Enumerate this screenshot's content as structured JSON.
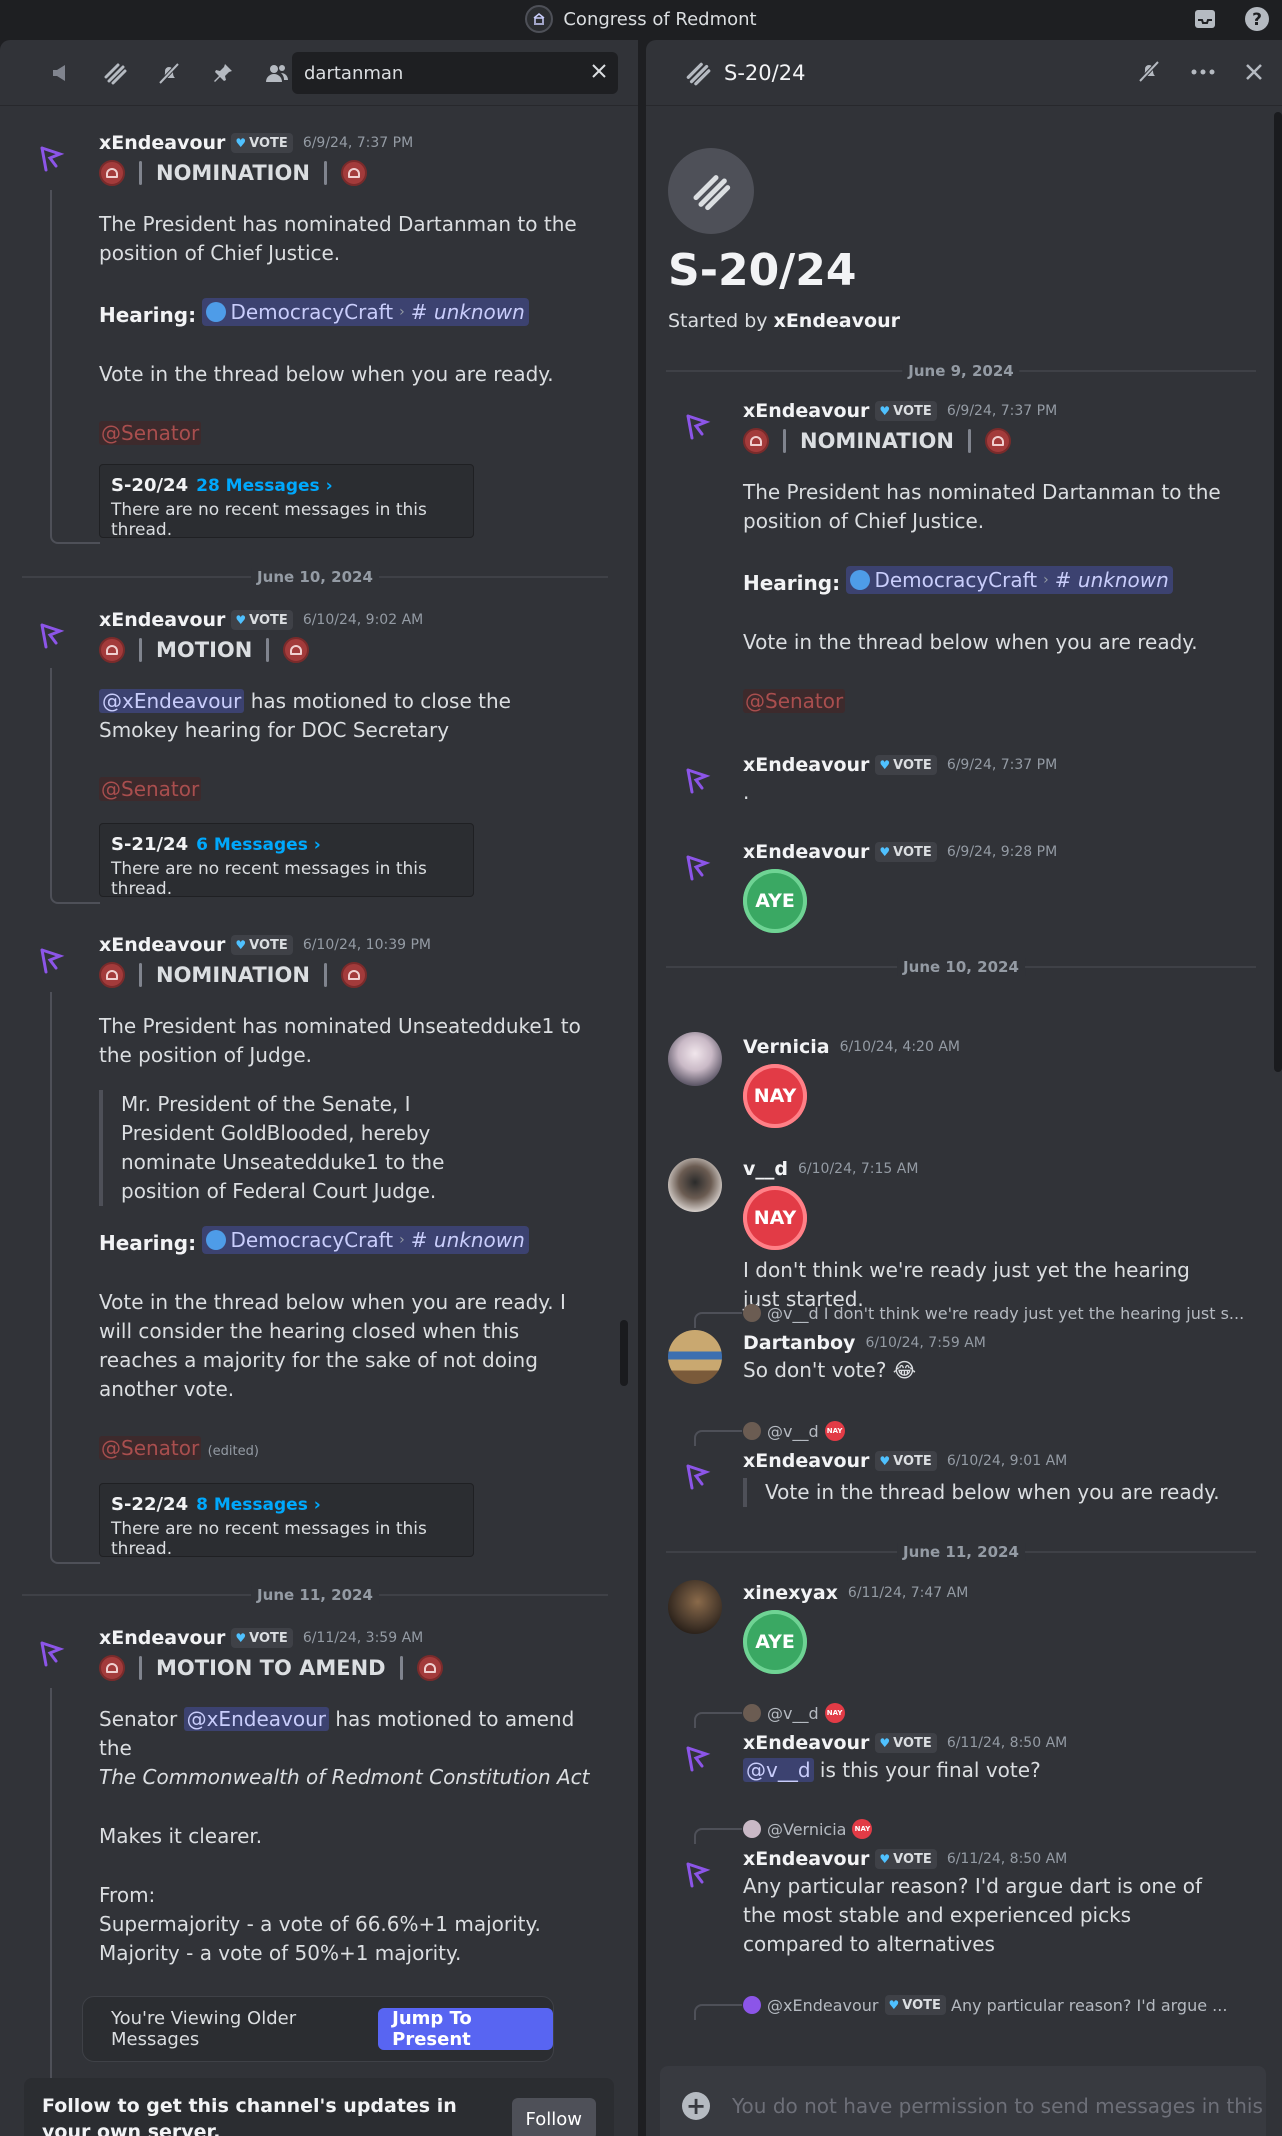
{
  "window": {
    "title": "Congress of Redmont"
  },
  "search": {
    "value": "dartanman"
  },
  "left_messages": [
    {
      "author": "xEndeavour",
      "badge": "VOTE",
      "time": "6/9/24, 7:37 PM",
      "heading": "NOMINATION",
      "p1": "The President has nominated Dartanman to the position of Chief Justice.",
      "hearing_label": "Hearing:",
      "channel": "DemocracyCraft",
      "subchannel": "unknown",
      "p2": "Vote in the thread below when you are ready.",
      "mention": "@Senator",
      "thread": {
        "name": "S-20/24",
        "count": "28 Messages ›",
        "note": "There are no recent messages in this thread."
      }
    },
    {
      "author": "xEndeavour",
      "badge": "VOTE",
      "time": "6/10/24, 9:02 AM",
      "heading": "MOTION",
      "mention_user": "@xEndeavour",
      "p1": " has motioned to close the Smokey hearing for DOC Secretary",
      "mention": "@Senator",
      "thread": {
        "name": "S-21/24",
        "count": "6 Messages ›",
        "note": "There are no recent messages in this thread."
      }
    },
    {
      "author": "xEndeavour",
      "badge": "VOTE",
      "time": "6/10/24, 10:39 PM",
      "heading": "NOMINATION",
      "p1": "The President has nominated Unseatedduke1 to the position of Judge.",
      "quote": "Mr. President of the Senate, I President GoldBlooded, hereby nominate Unseatedduke1 to the position of Federal Court Judge.",
      "hearing_label": "Hearing:",
      "channel": "DemocracyCraft",
      "subchannel": "unknown",
      "p2": "Vote in the thread below when you are ready. I will consider the hearing closed when this reaches a majority for the sake of not doing another vote.",
      "mention": "@Senator",
      "edited": "(edited)",
      "thread": {
        "name": "S-22/24",
        "count": "8 Messages ›",
        "note": "There are no recent messages in this thread."
      }
    },
    {
      "author": "xEndeavour",
      "badge": "VOTE",
      "time": "6/11/24, 3:59 AM",
      "heading": "MOTION TO AMEND",
      "pre": "Senator ",
      "mention_user": "@xEndeavour",
      "p1": " has motioned to amend the",
      "act": "The Commonwealth of Redmont Constitution Act",
      "p2": "Makes it clearer.",
      "p3": "From:",
      "p4": "Supermajority - a vote of 66.6%+1 majority.",
      "p5": "Majority - a vote of 50%+1 majority."
    }
  ],
  "left_dividers": [
    "June 10, 2024",
    "June 11, 2024"
  ],
  "older_bar": {
    "text": "You're Viewing Older Messages",
    "button": "Jump To Present"
  },
  "follow_bar": {
    "text": "Follow to get this channel's updates in your own server.",
    "button": "Follow"
  },
  "thread_panel": {
    "title": "S-20/24",
    "started_prefix": "Started by ",
    "starter": "xEndeavour",
    "dividers": [
      "June 9, 2024",
      "June 10, 2024",
      "June 11, 2024"
    ],
    "msg1": {
      "author": "xEndeavour",
      "badge": "VOTE",
      "time": "6/9/24, 7:37 PM",
      "heading": "NOMINATION",
      "p1": "The President has nominated Dartanman to the position of Chief Justice.",
      "hearing_label": "Hearing:",
      "channel": "DemocracyCraft",
      "subchannel": "unknown",
      "p2": "Vote in the thread below when you are ready.",
      "mention": "@Senator"
    },
    "msg2": {
      "author": "xEndeavour",
      "badge": "VOTE",
      "time": "6/9/24, 7:37 PM",
      "text": "."
    },
    "msg3": {
      "author": "xEndeavour",
      "badge": "VOTE",
      "time": "6/9/24, 9:28 PM",
      "react": "AYE"
    },
    "msg4": {
      "author": "Vernicia",
      "time": "6/10/24, 4:20 AM",
      "react": "NAY"
    },
    "msg5": {
      "author": "v__d",
      "time": "6/10/24, 7:15 AM",
      "react": "NAY",
      "text": "I don't think we're ready just yet the hearing just started."
    },
    "msg6": {
      "reply_user": "@v__d",
      "reply_text": "I don't think we're ready just yet the hearing just s...",
      "author": "Dartanboy",
      "time": "6/10/24, 7:59 AM",
      "text": "So don't vote? 😂"
    },
    "msg7": {
      "reply_user": "@v__d",
      "reply_badge": "NAY",
      "author": "xEndeavour",
      "badge": "VOTE",
      "time": "6/10/24, 9:01 AM",
      "quote": "Vote in the thread below when you are ready."
    },
    "msg8": {
      "author": "xinexyax",
      "time": "6/11/24, 7:47 AM",
      "react": "AYE"
    },
    "msg9": {
      "reply_user": "@v__d",
      "reply_badge": "NAY",
      "author": "xEndeavour",
      "badge": "VOTE",
      "time": "6/11/24, 8:50 AM",
      "mention": "@v__d",
      "text": " is this your final vote?"
    },
    "msg10": {
      "reply_user": "@Vernicia",
      "reply_badge": "NAY",
      "author": "xEndeavour",
      "badge": "VOTE",
      "time": "6/11/24, 8:50 AM",
      "text": "Any particular reason? I'd argue dart is one of the most stable and experienced picks compared to alternatives"
    },
    "msg11": {
      "reply_user": "@xEndeavour",
      "reply_badge": "VOTE",
      "reply_text": "Any particular reason? I'd argue ..."
    },
    "input_placeholder": "You do not have permission to send messages in this c..."
  },
  "colors": {
    "accent": "#5865f2",
    "aye": "#3aa863",
    "nay": "#e23b46",
    "link": "#00a8fc"
  }
}
